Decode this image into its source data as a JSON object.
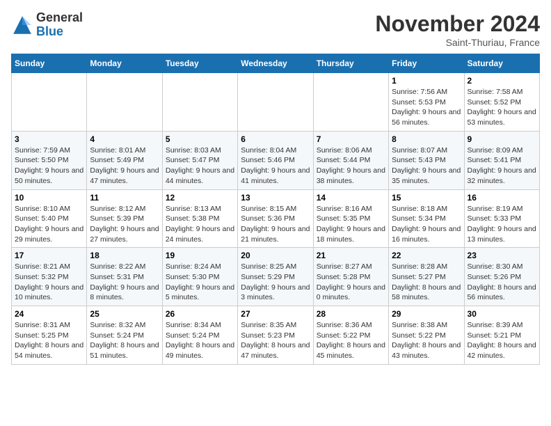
{
  "logo": {
    "line1": "General",
    "line2": "Blue"
  },
  "title": "November 2024",
  "location": "Saint-Thuriau, France",
  "days_header": [
    "Sunday",
    "Monday",
    "Tuesday",
    "Wednesday",
    "Thursday",
    "Friday",
    "Saturday"
  ],
  "weeks": [
    [
      {
        "day": "",
        "sunrise": "",
        "sunset": "",
        "daylight": ""
      },
      {
        "day": "",
        "sunrise": "",
        "sunset": "",
        "daylight": ""
      },
      {
        "day": "",
        "sunrise": "",
        "sunset": "",
        "daylight": ""
      },
      {
        "day": "",
        "sunrise": "",
        "sunset": "",
        "daylight": ""
      },
      {
        "day": "",
        "sunrise": "",
        "sunset": "",
        "daylight": ""
      },
      {
        "day": "1",
        "sunrise": "Sunrise: 7:56 AM",
        "sunset": "Sunset: 5:53 PM",
        "daylight": "Daylight: 9 hours and 56 minutes."
      },
      {
        "day": "2",
        "sunrise": "Sunrise: 7:58 AM",
        "sunset": "Sunset: 5:52 PM",
        "daylight": "Daylight: 9 hours and 53 minutes."
      }
    ],
    [
      {
        "day": "3",
        "sunrise": "Sunrise: 7:59 AM",
        "sunset": "Sunset: 5:50 PM",
        "daylight": "Daylight: 9 hours and 50 minutes."
      },
      {
        "day": "4",
        "sunrise": "Sunrise: 8:01 AM",
        "sunset": "Sunset: 5:49 PM",
        "daylight": "Daylight: 9 hours and 47 minutes."
      },
      {
        "day": "5",
        "sunrise": "Sunrise: 8:03 AM",
        "sunset": "Sunset: 5:47 PM",
        "daylight": "Daylight: 9 hours and 44 minutes."
      },
      {
        "day": "6",
        "sunrise": "Sunrise: 8:04 AM",
        "sunset": "Sunset: 5:46 PM",
        "daylight": "Daylight: 9 hours and 41 minutes."
      },
      {
        "day": "7",
        "sunrise": "Sunrise: 8:06 AM",
        "sunset": "Sunset: 5:44 PM",
        "daylight": "Daylight: 9 hours and 38 minutes."
      },
      {
        "day": "8",
        "sunrise": "Sunrise: 8:07 AM",
        "sunset": "Sunset: 5:43 PM",
        "daylight": "Daylight: 9 hours and 35 minutes."
      },
      {
        "day": "9",
        "sunrise": "Sunrise: 8:09 AM",
        "sunset": "Sunset: 5:41 PM",
        "daylight": "Daylight: 9 hours and 32 minutes."
      }
    ],
    [
      {
        "day": "10",
        "sunrise": "Sunrise: 8:10 AM",
        "sunset": "Sunset: 5:40 PM",
        "daylight": "Daylight: 9 hours and 29 minutes."
      },
      {
        "day": "11",
        "sunrise": "Sunrise: 8:12 AM",
        "sunset": "Sunset: 5:39 PM",
        "daylight": "Daylight: 9 hours and 27 minutes."
      },
      {
        "day": "12",
        "sunrise": "Sunrise: 8:13 AM",
        "sunset": "Sunset: 5:38 PM",
        "daylight": "Daylight: 9 hours and 24 minutes."
      },
      {
        "day": "13",
        "sunrise": "Sunrise: 8:15 AM",
        "sunset": "Sunset: 5:36 PM",
        "daylight": "Daylight: 9 hours and 21 minutes."
      },
      {
        "day": "14",
        "sunrise": "Sunrise: 8:16 AM",
        "sunset": "Sunset: 5:35 PM",
        "daylight": "Daylight: 9 hours and 18 minutes."
      },
      {
        "day": "15",
        "sunrise": "Sunrise: 8:18 AM",
        "sunset": "Sunset: 5:34 PM",
        "daylight": "Daylight: 9 hours and 16 minutes."
      },
      {
        "day": "16",
        "sunrise": "Sunrise: 8:19 AM",
        "sunset": "Sunset: 5:33 PM",
        "daylight": "Daylight: 9 hours and 13 minutes."
      }
    ],
    [
      {
        "day": "17",
        "sunrise": "Sunrise: 8:21 AM",
        "sunset": "Sunset: 5:32 PM",
        "daylight": "Daylight: 9 hours and 10 minutes."
      },
      {
        "day": "18",
        "sunrise": "Sunrise: 8:22 AM",
        "sunset": "Sunset: 5:31 PM",
        "daylight": "Daylight: 9 hours and 8 minutes."
      },
      {
        "day": "19",
        "sunrise": "Sunrise: 8:24 AM",
        "sunset": "Sunset: 5:30 PM",
        "daylight": "Daylight: 9 hours and 5 minutes."
      },
      {
        "day": "20",
        "sunrise": "Sunrise: 8:25 AM",
        "sunset": "Sunset: 5:29 PM",
        "daylight": "Daylight: 9 hours and 3 minutes."
      },
      {
        "day": "21",
        "sunrise": "Sunrise: 8:27 AM",
        "sunset": "Sunset: 5:28 PM",
        "daylight": "Daylight: 9 hours and 0 minutes."
      },
      {
        "day": "22",
        "sunrise": "Sunrise: 8:28 AM",
        "sunset": "Sunset: 5:27 PM",
        "daylight": "Daylight: 8 hours and 58 minutes."
      },
      {
        "day": "23",
        "sunrise": "Sunrise: 8:30 AM",
        "sunset": "Sunset: 5:26 PM",
        "daylight": "Daylight: 8 hours and 56 minutes."
      }
    ],
    [
      {
        "day": "24",
        "sunrise": "Sunrise: 8:31 AM",
        "sunset": "Sunset: 5:25 PM",
        "daylight": "Daylight: 8 hours and 54 minutes."
      },
      {
        "day": "25",
        "sunrise": "Sunrise: 8:32 AM",
        "sunset": "Sunset: 5:24 PM",
        "daylight": "Daylight: 8 hours and 51 minutes."
      },
      {
        "day": "26",
        "sunrise": "Sunrise: 8:34 AM",
        "sunset": "Sunset: 5:24 PM",
        "daylight": "Daylight: 8 hours and 49 minutes."
      },
      {
        "day": "27",
        "sunrise": "Sunrise: 8:35 AM",
        "sunset": "Sunset: 5:23 PM",
        "daylight": "Daylight: 8 hours and 47 minutes."
      },
      {
        "day": "28",
        "sunrise": "Sunrise: 8:36 AM",
        "sunset": "Sunset: 5:22 PM",
        "daylight": "Daylight: 8 hours and 45 minutes."
      },
      {
        "day": "29",
        "sunrise": "Sunrise: 8:38 AM",
        "sunset": "Sunset: 5:22 PM",
        "daylight": "Daylight: 8 hours and 43 minutes."
      },
      {
        "day": "30",
        "sunrise": "Sunrise: 8:39 AM",
        "sunset": "Sunset: 5:21 PM",
        "daylight": "Daylight: 8 hours and 42 minutes."
      }
    ]
  ]
}
